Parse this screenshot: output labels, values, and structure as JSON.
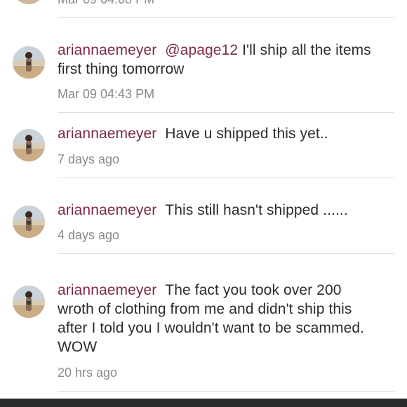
{
  "feed": {
    "top_partial_timestamp": "Mar 09 04:08 PM",
    "comments": [
      {
        "username": "ariannaemeyer",
        "mention": "@apage12",
        "message": " I'll ship all the items first thing tomorrow",
        "timestamp": "Mar 09 04:43 PM"
      },
      {
        "username": "ariannaemeyer",
        "mention": "",
        "message": "Have u shipped this yet..",
        "timestamp": "7 days ago"
      },
      {
        "username": "ariannaemeyer",
        "mention": "",
        "message": "This still hasn't shipped ......",
        "timestamp": "4 days ago"
      },
      {
        "username": "ariannaemeyer",
        "mention": "",
        "message": "The fact you took over 200 wroth of clothing from me and didn't ship this after I told you I wouldn't want to be scammed. WOW",
        "timestamp": "20 hrs ago"
      }
    ]
  },
  "colors": {
    "username": "#7d2a45",
    "text": "#2c2c2c",
    "timestamp": "#8a8a8a",
    "divider": "#dcdcdc",
    "bottom_bar": "#2a2a2a"
  },
  "icons": {
    "avatar": "user-profile-photo"
  }
}
